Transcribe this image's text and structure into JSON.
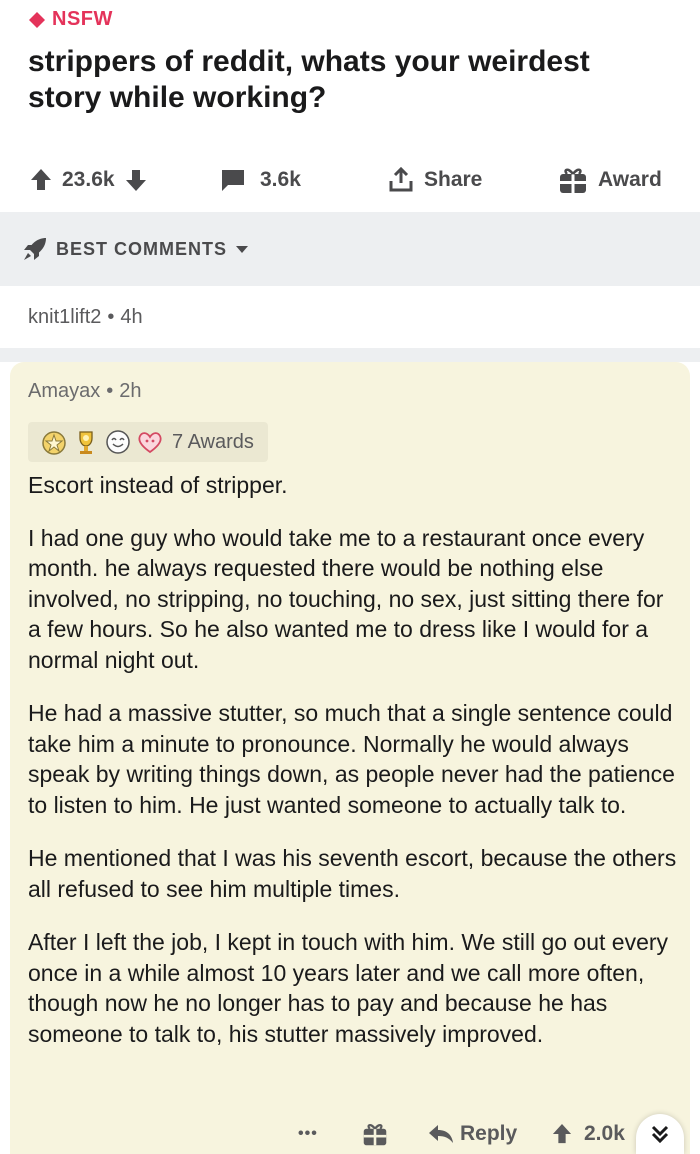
{
  "post": {
    "nsfw_label": "NSFW",
    "title": "strippers of reddit, whats your weirdest story while working?",
    "upvotes": "23.6k",
    "comments": "3.6k",
    "share_label": "Share",
    "award_label": "Award"
  },
  "sort": {
    "label": "BEST COMMENTS"
  },
  "collapsed_comment": {
    "author": "knit1lift2",
    "age": "4h"
  },
  "comment": {
    "author": "Amayax",
    "age": "2h",
    "awards_label": "7 Awards",
    "paragraphs": [
      "Escort instead of stripper.",
      "I had one guy who would take me to a restaurant once every month. he always requested there would be nothing else involved, no stripping, no touching, no sex, just sitting there for a few hours. So he also wanted me to dress like I would for a normal night out.",
      "He had a massive stutter, so much that a single sentence could take him a minute to pronounce. Normally he would always speak by writing things down, as people never had the patience to listen to him. He just wanted someone to actually talk to.",
      "He mentioned that I was his seventh escort, because the others all refused to see him multiple times.",
      "After I left the job, I kept in touch with him. We still go out every once in a while almost 10 years later and we call more often, though now he no longer has to pay and because he has someone to talk to, his stutter massively improved."
    ],
    "more_label": "•••",
    "reply_label": "Reply",
    "score": "2.0k"
  },
  "colors": {
    "nsfw": "#e4335a",
    "comment_bg": "#f7f4de",
    "separator_bg": "#edeff1",
    "muted_text": "#5a5a5c"
  },
  "icons": [
    "nsfw-diamond-icon",
    "upvote-arrow-icon",
    "downvote-arrow-icon",
    "comment-bubble-icon",
    "share-icon",
    "gift-icon",
    "rocket-icon",
    "caret-down-icon",
    "award-icons",
    "reply-arrow-icon",
    "chevron-down-double-icon"
  ]
}
